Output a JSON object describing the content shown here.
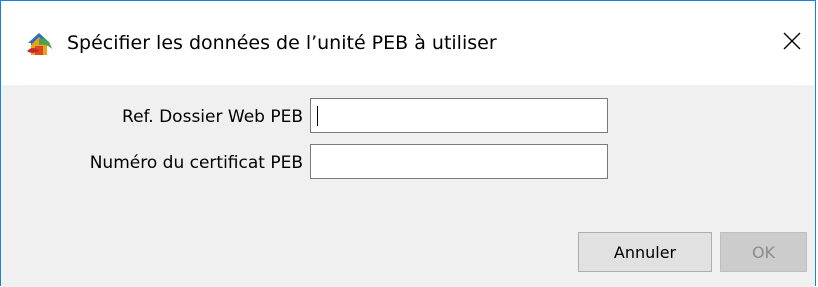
{
  "window": {
    "title": "Spécifier les données de l’unité PEB à utiliser",
    "app_icon": "peb-house-icon",
    "close_icon": "close-icon",
    "accent_color": "#1883d7"
  },
  "form": {
    "fields": [
      {
        "label": "Ref. Dossier Web PEB",
        "value": "",
        "focused": true
      },
      {
        "label": "Numéro du certificat PEB",
        "value": "",
        "focused": false
      }
    ]
  },
  "buttons": {
    "cancel_label": "Annuler",
    "ok_label": "OK",
    "ok_enabled": false
  }
}
